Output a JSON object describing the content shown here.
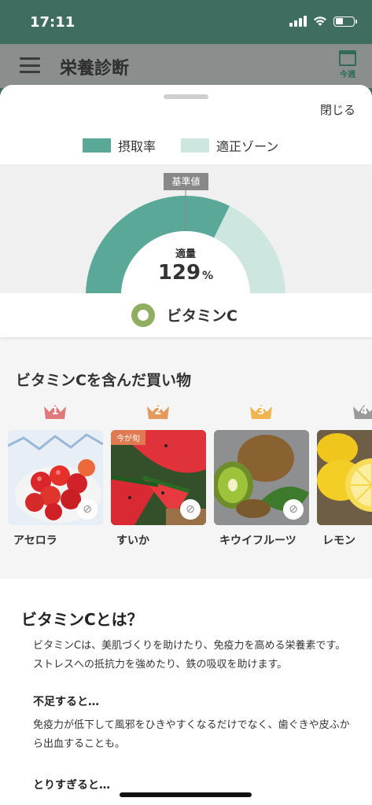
{
  "status_bar": {
    "time": "17:11",
    "battery_level": 0.45
  },
  "header": {
    "title": "栄養診断",
    "week_label": "今週",
    "menu_icon": "hamburger-icon",
    "calendar_icon": "calendar-icon"
  },
  "sheet": {
    "close_label": "閉じる",
    "legend": [
      {
        "label": "摂取率",
        "color": "#5aa897"
      },
      {
        "label": "適正ゾーン",
        "color": "#cde6df"
      }
    ]
  },
  "gauge": {
    "reference_label": "基準値",
    "status_label": "適量",
    "value": "129",
    "unit": "%",
    "intake_ratio": 1.29,
    "scale_max": 2.0,
    "proper_zone": [
      1.0,
      2.0
    ],
    "nutrient_name": "ビタミンC",
    "intake_color": "#5aa897",
    "zone_color": "#cde6df",
    "nutrient_icon_color": "#8fae60"
  },
  "shopping": {
    "title": "ビタミンCを含んだ買い物",
    "items": [
      {
        "rank": "1",
        "name": "アセロラ",
        "badge": "",
        "rank_color": "#e07a7a"
      },
      {
        "rank": "2",
        "name": "すいか",
        "badge": "今が旬",
        "rank_color": "#e49a5c"
      },
      {
        "rank": "3",
        "name": "キウイフルーツ",
        "badge": "",
        "rank_color": "#efb54e"
      },
      {
        "rank": "4",
        "name": "レモン",
        "badge": "",
        "rank_color": "#9a9a9a"
      }
    ]
  },
  "description": {
    "title": "ビタミンCとは？",
    "body": "ビタミンCは、美肌づくりを助けたり、免疫力を高める栄養素です。ストレスへの抵抗力を強めたり、鉄の吸収を助けます。",
    "shortage_title": "不足すると…",
    "shortage_text": "免疫力が低下して風邪をひきやすくなるだけでなく、歯ぐきや皮ふから出血することも。",
    "excess_title": "とりすぎると…"
  }
}
